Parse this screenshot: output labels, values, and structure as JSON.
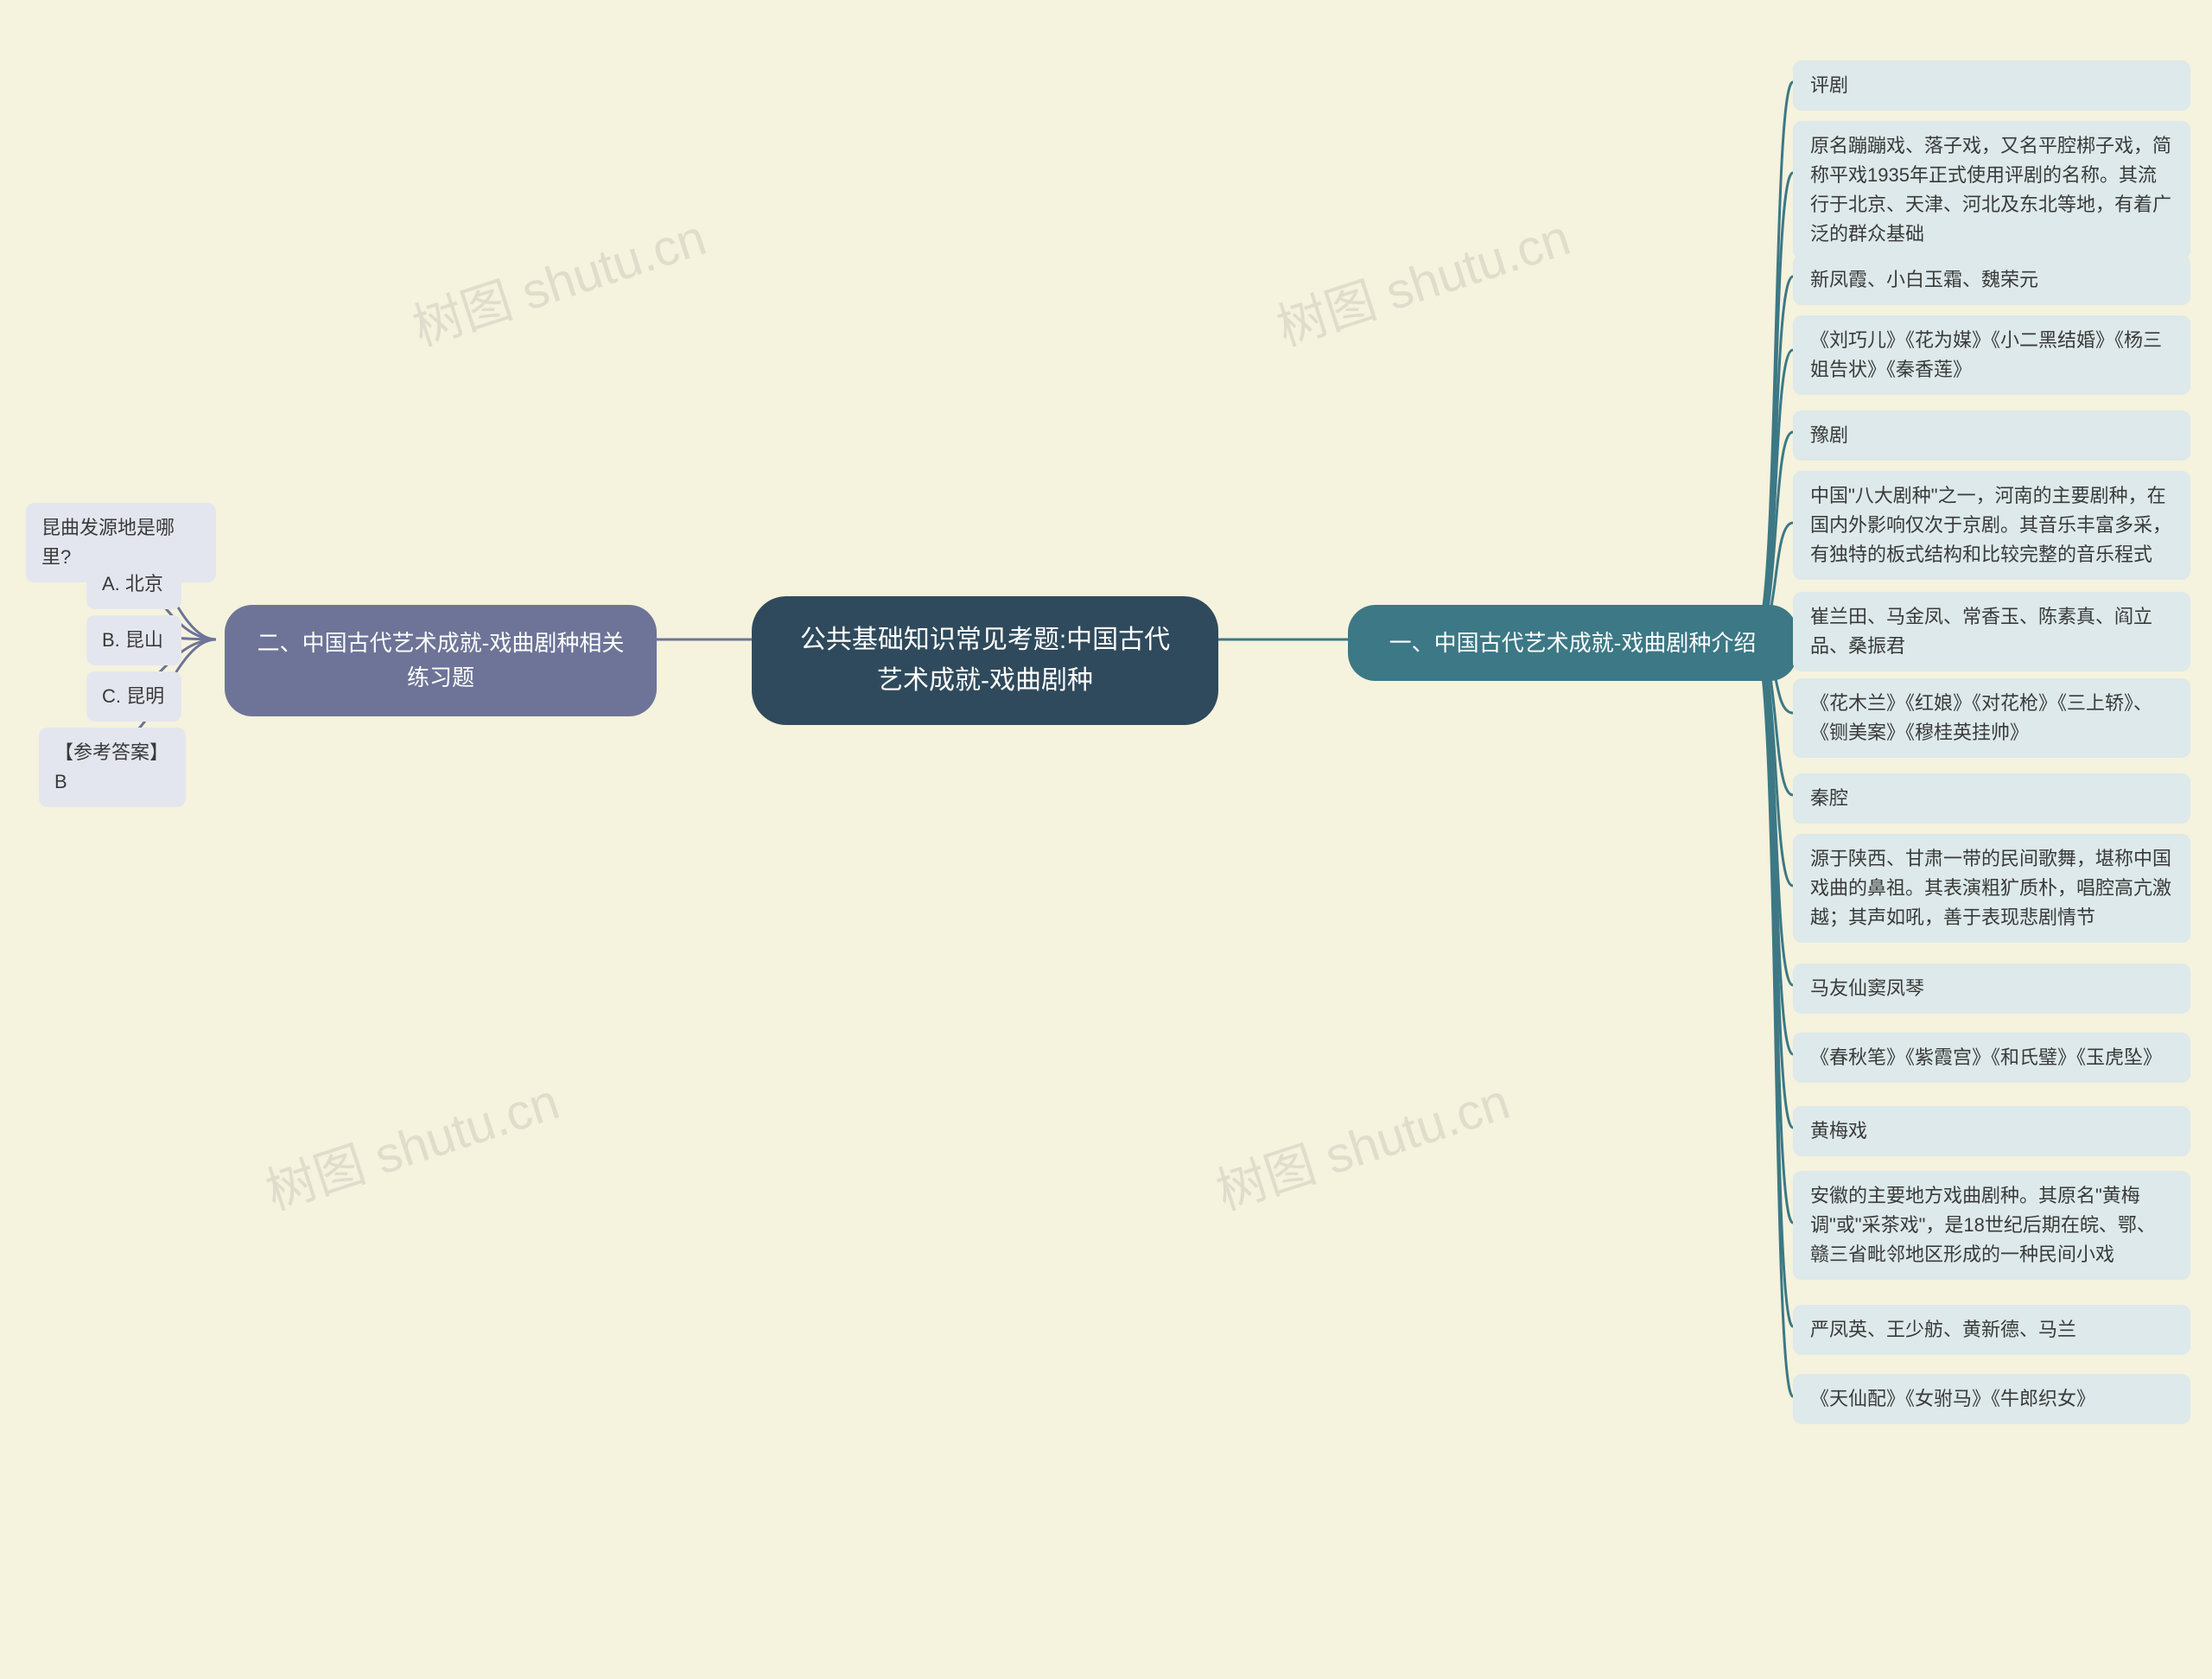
{
  "root": {
    "title": "公共基础知识常见考题:中国古代艺术成就-戏曲剧种"
  },
  "left": {
    "title": "二、中国古代艺术成就-戏曲剧种相关练习题",
    "items": [
      "昆曲发源地是哪里?",
      "A. 北京",
      "B. 昆山",
      "C. 昆明",
      "【参考答案】B"
    ]
  },
  "right": {
    "title": "一、中国古代艺术成就-戏曲剧种介绍",
    "items": [
      "评剧",
      "原名蹦蹦戏、落子戏，又名平腔梆子戏，简称平戏1935年正式使用评剧的名称。其流行于北京、天津、河北及东北等地，有着广泛的群众基础",
      "新凤霞、小白玉霜、魏荣元",
      "《刘巧儿》《花为媒》《小二黑结婚》《杨三姐告状》《秦香莲》",
      "豫剧",
      "中国\"八大剧种\"之一，河南的主要剧种，在国内外影响仅次于京剧。其音乐丰富多采，有独特的板式结构和比较完整的音乐程式",
      "崔兰田、马金凤、常香玉、陈素真、阎立品、桑振君",
      "《花木兰》《红娘》《对花枪》《三上轿》、《铡美案》《穆桂英挂帅》",
      "秦腔",
      "源于陕西、甘肃一带的民间歌舞，堪称中国戏曲的鼻祖。其表演粗犷质朴，唱腔高亢激越；其声如吼，善于表现悲剧情节",
      "马友仙窦凤琴",
      "《春秋笔》《紫霞宫》《和氏璧》《玉虎坠》",
      "黄梅戏",
      "安徽的主要地方戏曲剧种。其原名\"黄梅调\"或\"采茶戏\"，是18世纪后期在皖、鄂、赣三省毗邻地区形成的一种民间小戏",
      "严凤英、王少舫、黄新德、马兰",
      "《天仙配》《女驸马》《牛郎织女》"
    ]
  },
  "watermarks": [
    "树图 shutu.cn",
    "树图 shutu.cn",
    "树图 shutu.cn",
    "树图 shutu.cn"
  ]
}
